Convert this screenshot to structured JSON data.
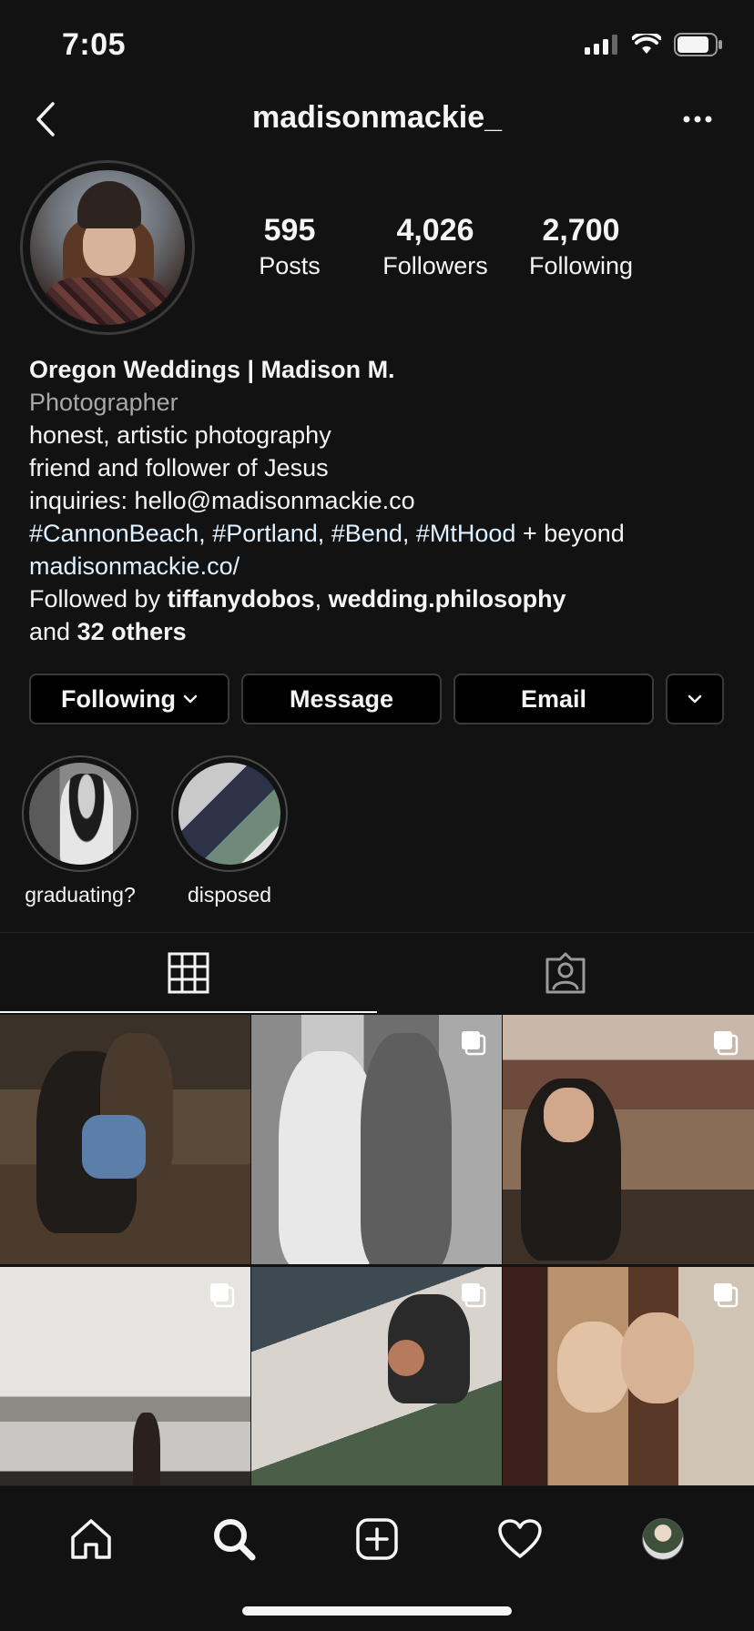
{
  "status_bar": {
    "time": "7:05"
  },
  "header": {
    "username": "madisonmackie_"
  },
  "stats": [
    {
      "value": "595",
      "label": "Posts"
    },
    {
      "value": "4,026",
      "label": "Followers"
    },
    {
      "value": "2,700",
      "label": "Following"
    }
  ],
  "bio": {
    "name": "Oregon Weddings | Madison M.",
    "category": "Photographer",
    "line1": "honest, artistic photography",
    "line2": "friend and follower of Jesus",
    "line3": "inquiries: hello@madisonmackie.co",
    "hashtags": [
      "#CannonBeach",
      "#Portland",
      "#Bend",
      "#MtHood"
    ],
    "hashtag_sep": ", ",
    "hashtag_suffix": " + beyond",
    "link": "madisonmackie.co/",
    "followed_by_prefix": "Followed by ",
    "followed_by_user1": "tiffanydobos",
    "followed_by_comma": ", ",
    "followed_by_user2": "wedding.philosophy",
    "followed_by_and": "and ",
    "followed_by_others": "32 others"
  },
  "actions": {
    "following_label": "Following",
    "message_label": "Message",
    "email_label": "Email"
  },
  "highlights": [
    {
      "label": "graduating?"
    },
    {
      "label": "disposed"
    }
  ],
  "tabs": [
    {
      "icon": "grid-icon",
      "active": true
    },
    {
      "icon": "tagged-icon",
      "active": false
    }
  ],
  "grid": [
    {
      "multi": false
    },
    {
      "multi": true
    },
    {
      "multi": true
    },
    {
      "multi": true
    },
    {
      "multi": true
    },
    {
      "multi": true
    }
  ],
  "colors": {
    "background": "#121212",
    "text": "#f5f5f5",
    "secondary_text": "#a8a8a8",
    "link": "#e0f1ff",
    "border": "#3a3a3a"
  }
}
